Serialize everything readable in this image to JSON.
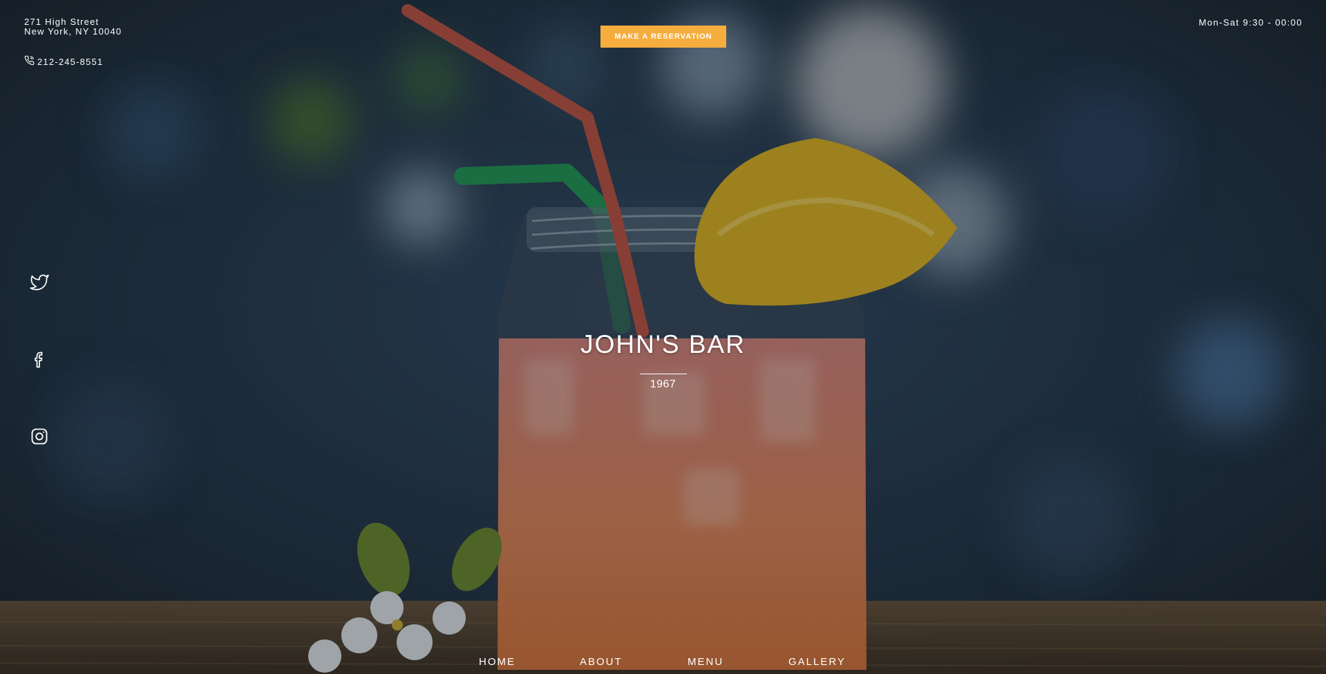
{
  "header": {
    "address_line1": "271 High Street",
    "address_line2": "New York, NY 10040",
    "phone": "212-245-8551",
    "hours": "Mon-Sat 9:30 - 00:00",
    "reservation_label": "MAKE A RESERVATION"
  },
  "brand": {
    "name": "JOHN'S BAR",
    "year": "1967"
  },
  "social": {
    "icons": [
      "twitter-icon",
      "facebook-icon",
      "instagram-icon"
    ]
  },
  "nav": {
    "items": [
      {
        "label": "HOME"
      },
      {
        "label": "ABOUT"
      },
      {
        "label": "MENU"
      },
      {
        "label": "GALLERY"
      }
    ]
  },
  "colors": {
    "accent": "#f5ad3d",
    "text": "#ffffff",
    "background": "#1e2a33"
  }
}
